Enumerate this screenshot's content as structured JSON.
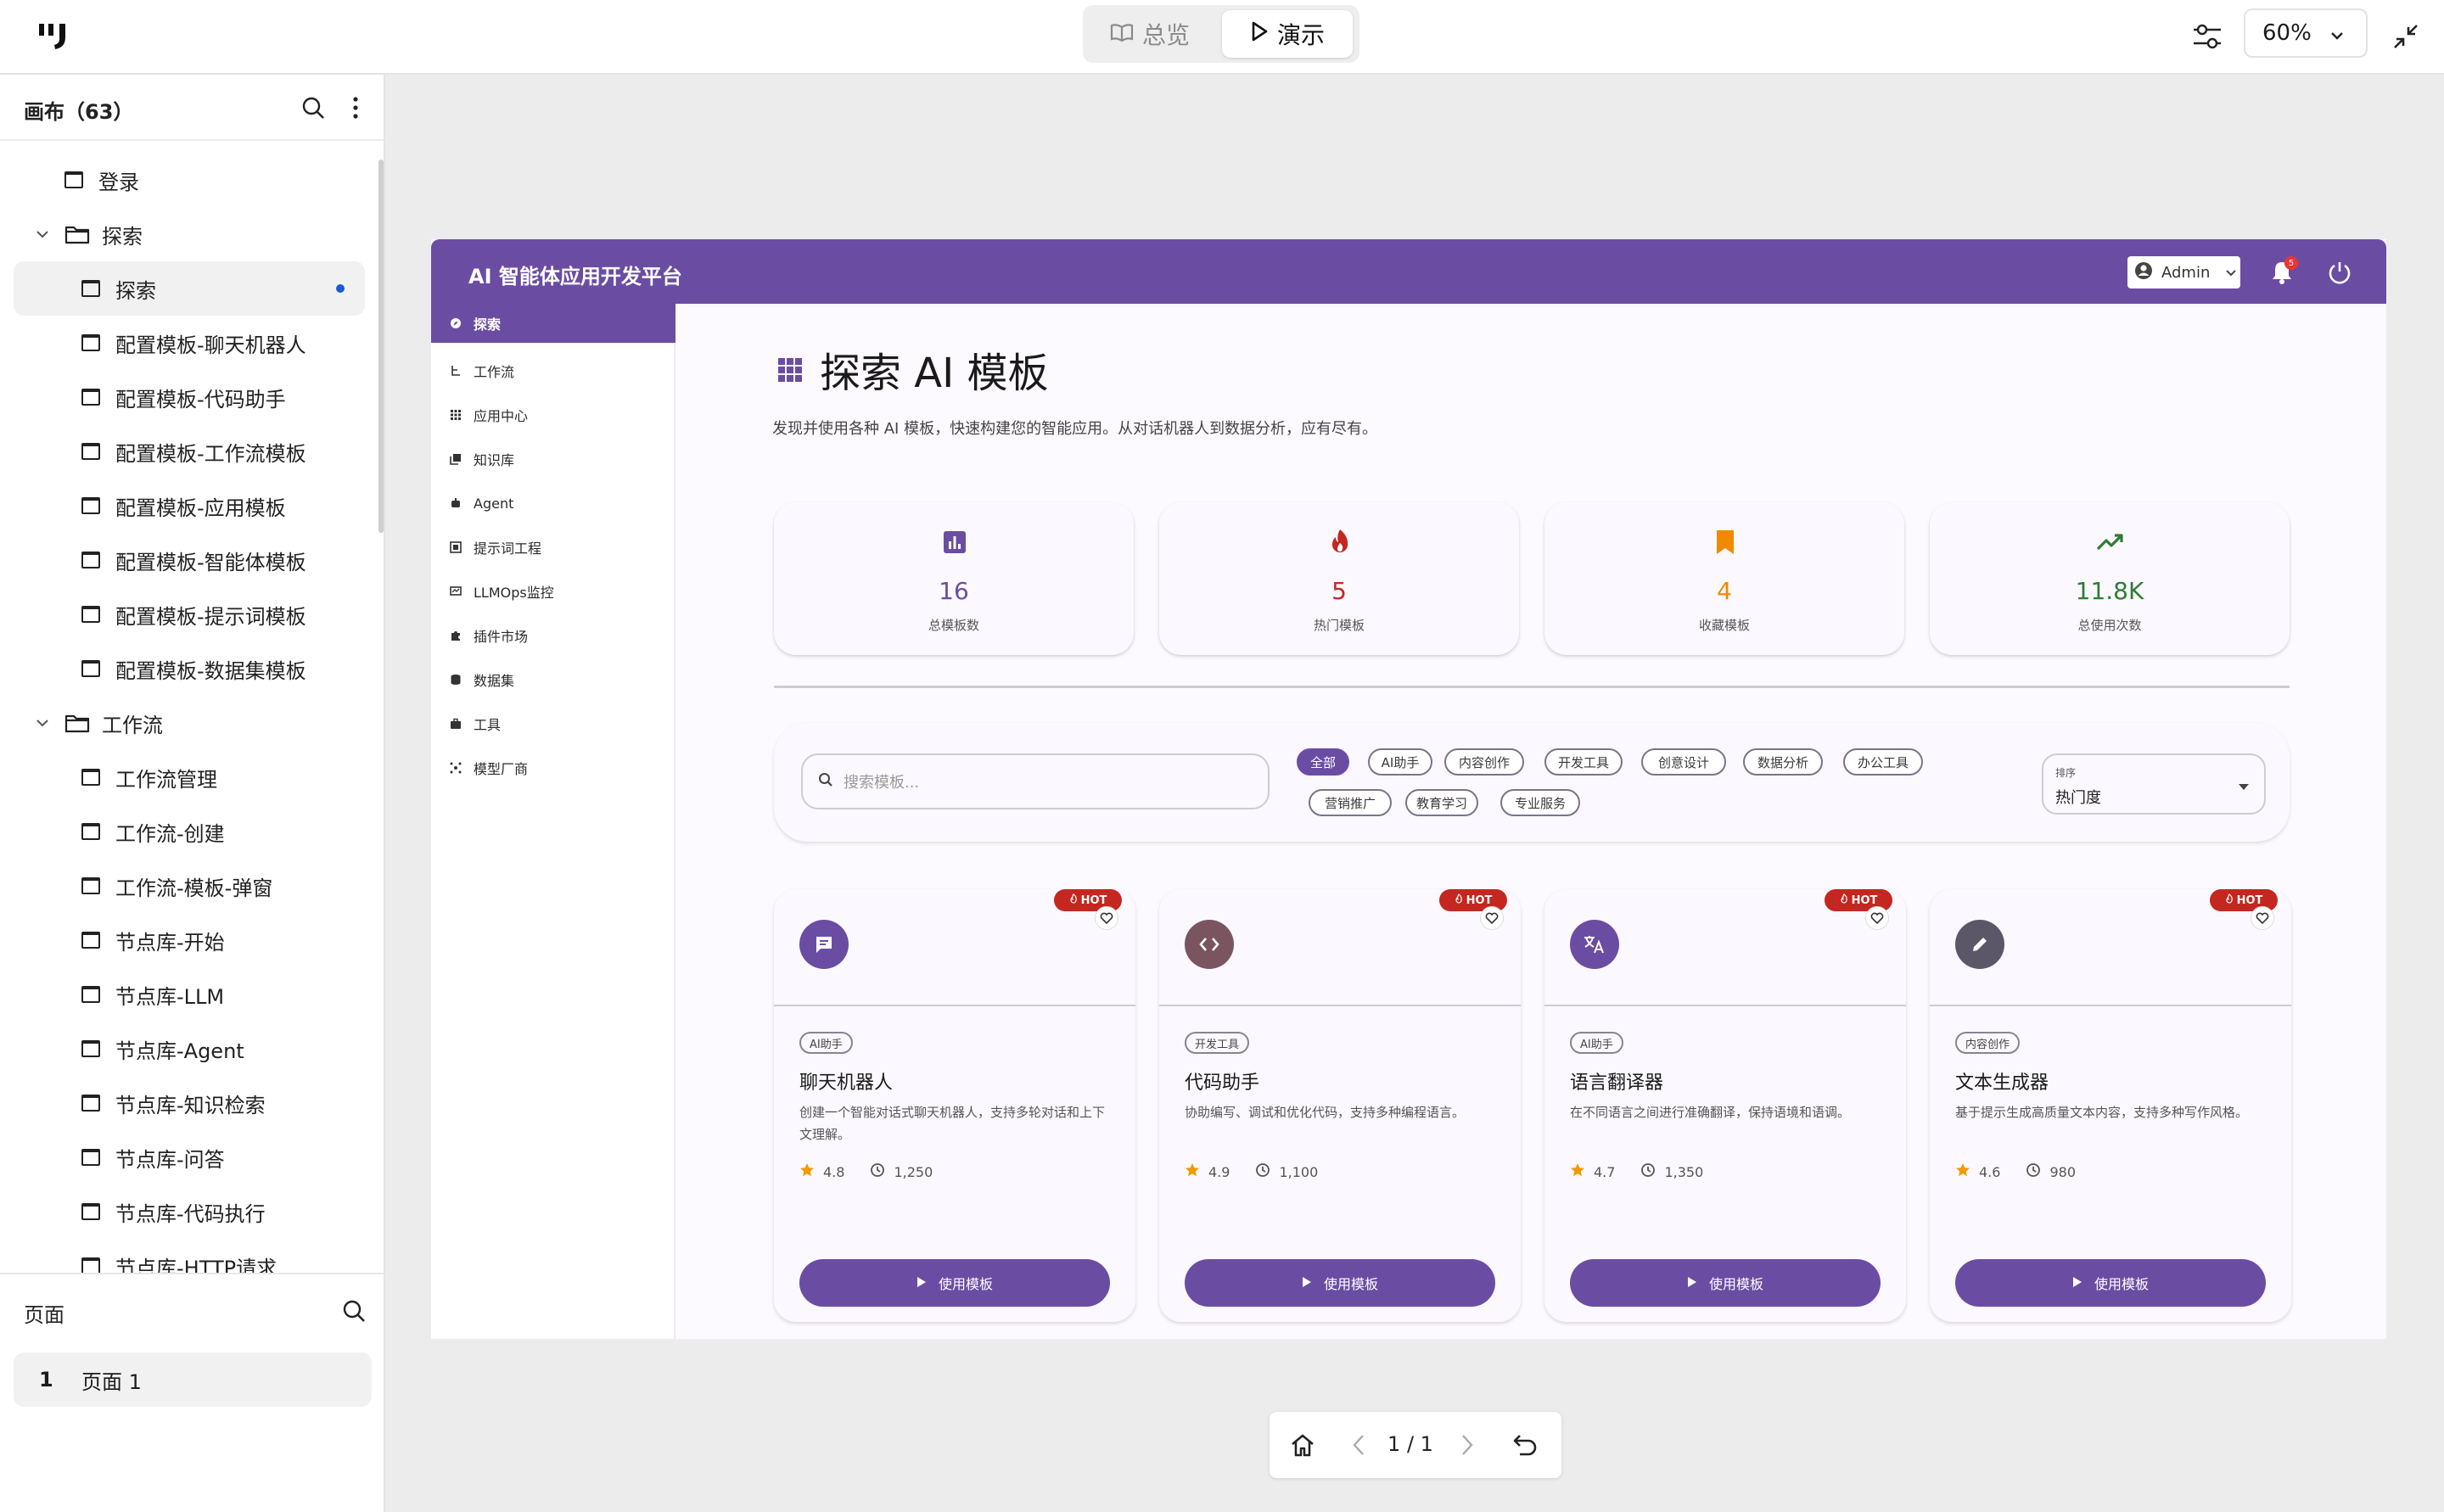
{
  "topbar": {
    "overview_label": "总览",
    "present_label": "演示",
    "zoom": "60%"
  },
  "left_panel": {
    "title": "画布（63）",
    "tree": [
      {
        "label": "登录",
        "type": "page",
        "level": 0
      },
      {
        "label": "探索",
        "type": "folder",
        "level": 0
      },
      {
        "label": "探索",
        "type": "page",
        "level": 1,
        "active": true
      },
      {
        "label": "配置模板-聊天机器人",
        "type": "page",
        "level": 1
      },
      {
        "label": "配置模板-代码助手",
        "type": "page",
        "level": 1
      },
      {
        "label": "配置模板-工作流模板",
        "type": "page",
        "level": 1
      },
      {
        "label": "配置模板-应用模板",
        "type": "page",
        "level": 1
      },
      {
        "label": "配置模板-智能体模板",
        "type": "page",
        "level": 1
      },
      {
        "label": "配置模板-提示词模板",
        "type": "page",
        "level": 1
      },
      {
        "label": "配置模板-数据集模板",
        "type": "page",
        "level": 1
      },
      {
        "label": "工作流",
        "type": "folder",
        "level": 0
      },
      {
        "label": "工作流管理",
        "type": "page",
        "level": 1
      },
      {
        "label": "工作流-创建",
        "type": "page",
        "level": 1
      },
      {
        "label": "工作流-模板-弹窗",
        "type": "page",
        "level": 1
      },
      {
        "label": "节点库-开始",
        "type": "page",
        "level": 1
      },
      {
        "label": "节点库-LLM",
        "type": "page",
        "level": 1
      },
      {
        "label": "节点库-Agent",
        "type": "page",
        "level": 1
      },
      {
        "label": "节点库-知识检索",
        "type": "page",
        "level": 1
      },
      {
        "label": "节点库-问答",
        "type": "page",
        "level": 1
      },
      {
        "label": "节点库-代码执行",
        "type": "page",
        "level": 1
      },
      {
        "label": "节点库-HTTP请求",
        "type": "page",
        "level": 1
      }
    ],
    "pages_title": "页面",
    "page_number": "1",
    "page_name": "页面 1"
  },
  "app": {
    "title": "AI 智能体应用开发平台",
    "admin_label": "Admin",
    "notification_count": "5",
    "sidebar": [
      {
        "label": "探索",
        "icon": "compass-icon",
        "active": true
      },
      {
        "label": "工作流",
        "icon": "workflow-icon"
      },
      {
        "label": "应用中心",
        "icon": "apps-icon"
      },
      {
        "label": "知识库",
        "icon": "library-icon"
      },
      {
        "label": "Agent",
        "icon": "robot-icon"
      },
      {
        "label": "提示词工程",
        "icon": "prompt-icon"
      },
      {
        "label": "LLMOps监控",
        "icon": "monitor-icon"
      },
      {
        "label": "插件市场",
        "icon": "puzzle-icon"
      },
      {
        "label": "数据集",
        "icon": "database-icon"
      },
      {
        "label": "工具",
        "icon": "toolbox-icon"
      },
      {
        "label": "模型厂商",
        "icon": "hub-icon"
      }
    ],
    "page_title": "探索 AI 模板",
    "description": "发现并使用各种 AI 模板，快速构建您的智能应用。从对话机器人到数据分析，应有尽有。",
    "stats": [
      {
        "value": "16",
        "label": "总模板数",
        "icon": "bar-chart-icon",
        "color": "#6a4da3"
      },
      {
        "value": "5",
        "label": "热门模板",
        "icon": "fire-icon",
        "color": "#c42620"
      },
      {
        "value": "4",
        "label": "收藏模板",
        "icon": "bookmark-icon",
        "color": "#f08a00"
      },
      {
        "value": "11.8K",
        "label": "总使用次数",
        "icon": "trending-up-icon",
        "color": "#2e7d32"
      }
    ],
    "search_placeholder": "搜索模板...",
    "categories": [
      "全部",
      "AI助手",
      "内容创作",
      "开发工具",
      "创意设计",
      "数据分析",
      "办公工具",
      "营销推广",
      "教育学习",
      "专业服务"
    ],
    "selected_category": "全部",
    "sort_label": "排序",
    "sort_value": "热门度",
    "templates": [
      {
        "tag": "AI助手",
        "title": "聊天机器人",
        "desc": "创建一个智能对话式聊天机器人，支持多轮对话和上下文理解。",
        "rating": "4.8",
        "uses": "1,250",
        "hot": "HOT",
        "icon": "chat-icon",
        "color": "#6a4da3"
      },
      {
        "tag": "开发工具",
        "title": "代码助手",
        "desc": "协助编写、调试和优化代码，支持多种编程语言。",
        "rating": "4.9",
        "uses": "1,100",
        "hot": "HOT",
        "icon": "code-icon",
        "color": "#7a5560"
      },
      {
        "tag": "AI助手",
        "title": "语言翻译器",
        "desc": "在不同语言之间进行准确翻译，保持语境和语调。",
        "rating": "4.7",
        "uses": "1,350",
        "hot": "HOT",
        "icon": "translate-icon",
        "color": "#6a4da3"
      },
      {
        "tag": "内容创作",
        "title": "文本生成器",
        "desc": "基于提示生成高质量文本内容，支持多种写作风格。",
        "rating": "4.6",
        "uses": "980",
        "hot": "HOT",
        "icon": "pencil-icon",
        "color": "#5c5669"
      }
    ],
    "use_button_label": "使用模板"
  },
  "pager": {
    "text": "1 / 1"
  }
}
